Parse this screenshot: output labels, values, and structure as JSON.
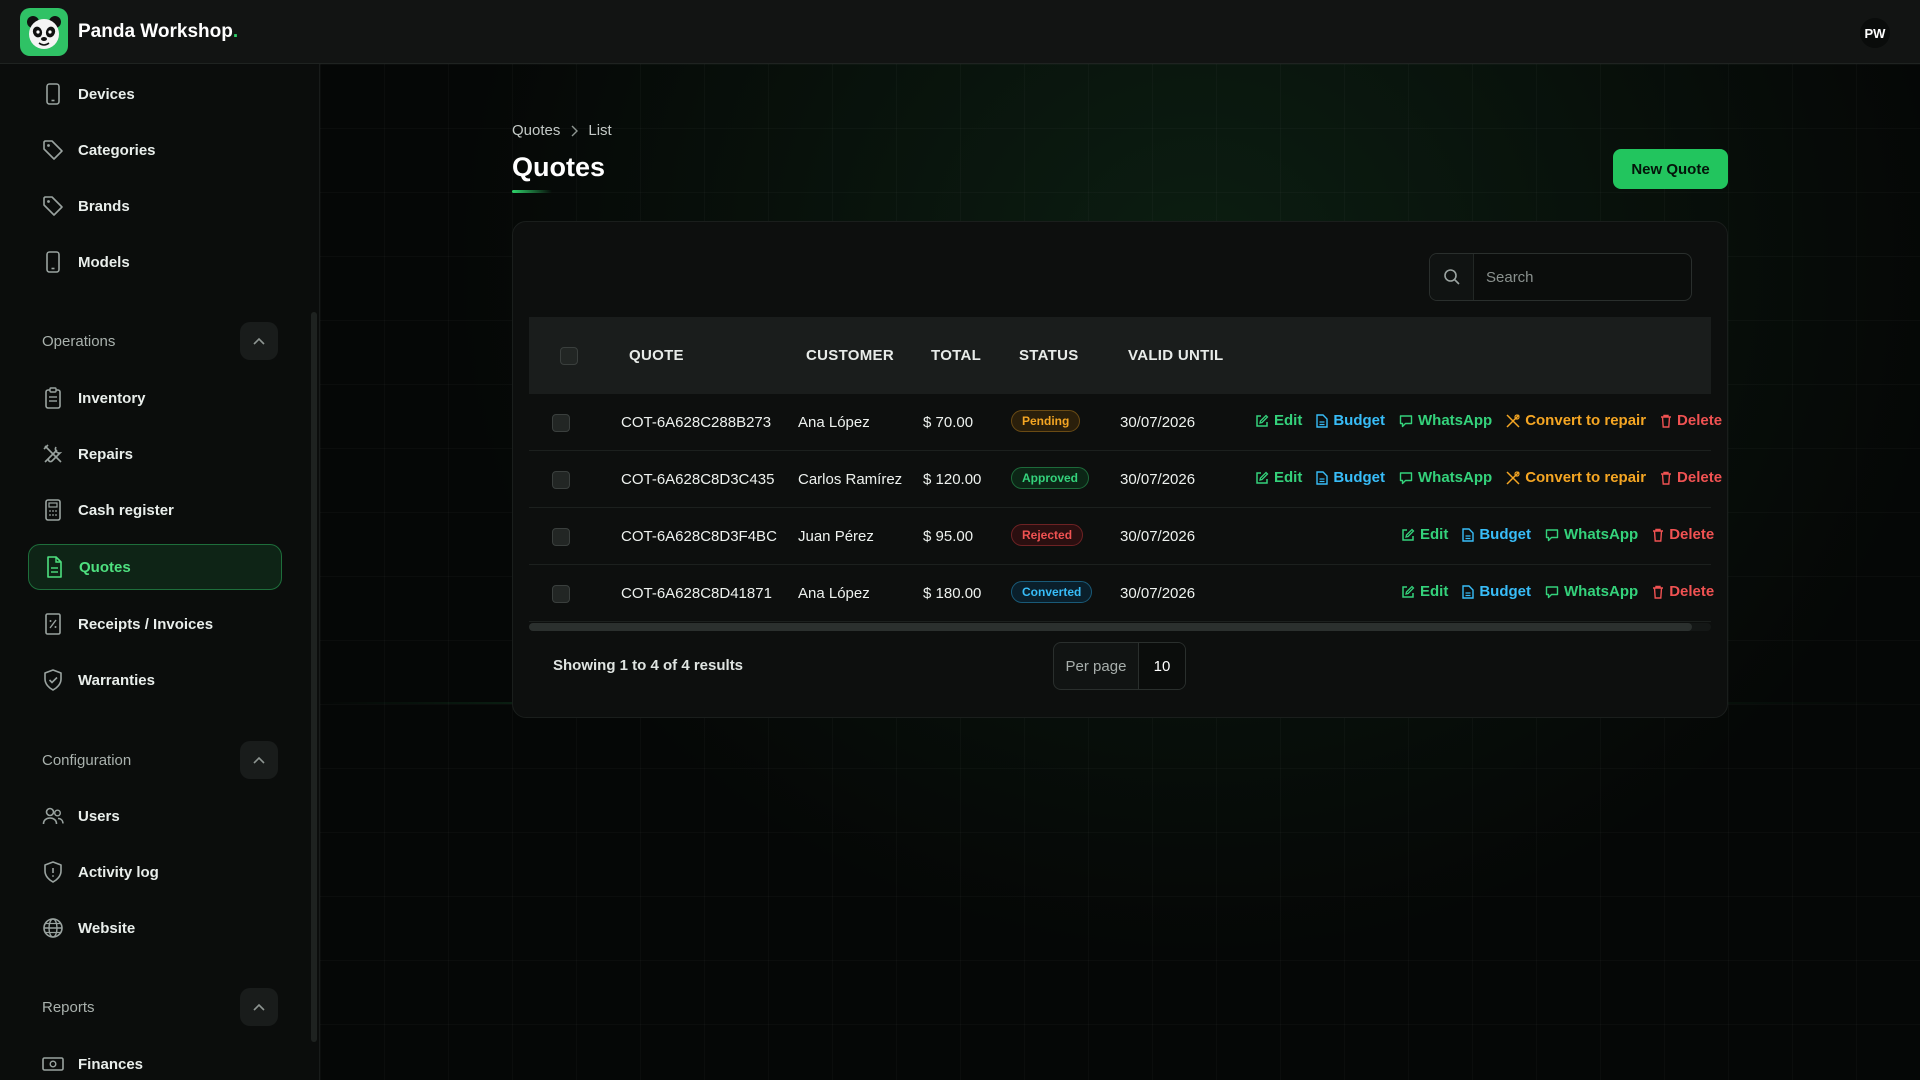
{
  "app": {
    "name": "Panda Workshop",
    "name_dot": ".",
    "avatar_initials": "PW"
  },
  "sidebar": {
    "top_items": [
      {
        "label": "Devices",
        "icon": "phone-icon"
      },
      {
        "label": "Categories",
        "icon": "tag-icon"
      },
      {
        "label": "Brands",
        "icon": "tag-icon"
      },
      {
        "label": "Models",
        "icon": "phone-icon"
      }
    ],
    "groups": [
      {
        "label": "Operations",
        "items": [
          {
            "label": "Inventory",
            "icon": "clipboard-icon"
          },
          {
            "label": "Repairs",
            "icon": "tools-icon"
          },
          {
            "label": "Cash register",
            "icon": "calculator-icon"
          },
          {
            "label": "Quotes",
            "icon": "document-icon",
            "active": true
          },
          {
            "label": "Receipts / Invoices",
            "icon": "receipt-icon"
          },
          {
            "label": "Warranties",
            "icon": "shield-check-icon"
          }
        ]
      },
      {
        "label": "Configuration",
        "items": [
          {
            "label": "Users",
            "icon": "users-icon"
          },
          {
            "label": "Activity log",
            "icon": "shield-icon"
          },
          {
            "label": "Website",
            "icon": "globe-icon"
          }
        ]
      },
      {
        "label": "Reports",
        "items": [
          {
            "label": "Finances",
            "icon": "cash-icon"
          }
        ]
      }
    ]
  },
  "breadcrumb": {
    "root": "Quotes",
    "current": "List"
  },
  "page": {
    "title": "Quotes",
    "new_button": "New Quote"
  },
  "search": {
    "placeholder": "Search"
  },
  "table": {
    "columns": [
      "QUOTE",
      "CUSTOMER",
      "TOTAL",
      "STATUS",
      "VALID UNTIL"
    ],
    "rows": [
      {
        "quote": "COT-6A628C288B273",
        "customer": "Ana López",
        "total": "$ 70.00",
        "status": "Pending",
        "valid_until": "30/07/2026",
        "actions": [
          "Edit",
          "Budget",
          "WhatsApp",
          "Convert to repair",
          "Delete"
        ]
      },
      {
        "quote": "COT-6A628C8D3C435",
        "customer": "Carlos Ramírez",
        "total": "$ 120.00",
        "status": "Approved",
        "valid_until": "30/07/2026",
        "actions": [
          "Edit",
          "Budget",
          "WhatsApp",
          "Convert to repair",
          "Delete"
        ]
      },
      {
        "quote": "COT-6A628C8D3F4BC",
        "customer": "Juan Pérez",
        "total": "$ 95.00",
        "status": "Rejected",
        "valid_until": "30/07/2026",
        "actions": [
          "Edit",
          "Budget",
          "WhatsApp",
          "Delete"
        ]
      },
      {
        "quote": "COT-6A628C8D41871",
        "customer": "Ana López",
        "total": "$ 180.00",
        "status": "Converted",
        "valid_until": "30/07/2026",
        "actions": [
          "Edit",
          "Budget",
          "WhatsApp",
          "Delete"
        ]
      }
    ]
  },
  "footer": {
    "summary": "Showing 1 to 4 of 4 results",
    "per_page_label": "Per page",
    "per_page_value": "10"
  },
  "colors": {
    "accent": "#22c55e",
    "edit": "#34d27b",
    "budget": "#38bdf8",
    "whatsapp": "#34d27b",
    "convert": "#f5a623",
    "delete": "#f05252",
    "pending": "#f5a623",
    "approved": "#34d27b",
    "rejected": "#f05252",
    "converted": "#38bdf8"
  }
}
